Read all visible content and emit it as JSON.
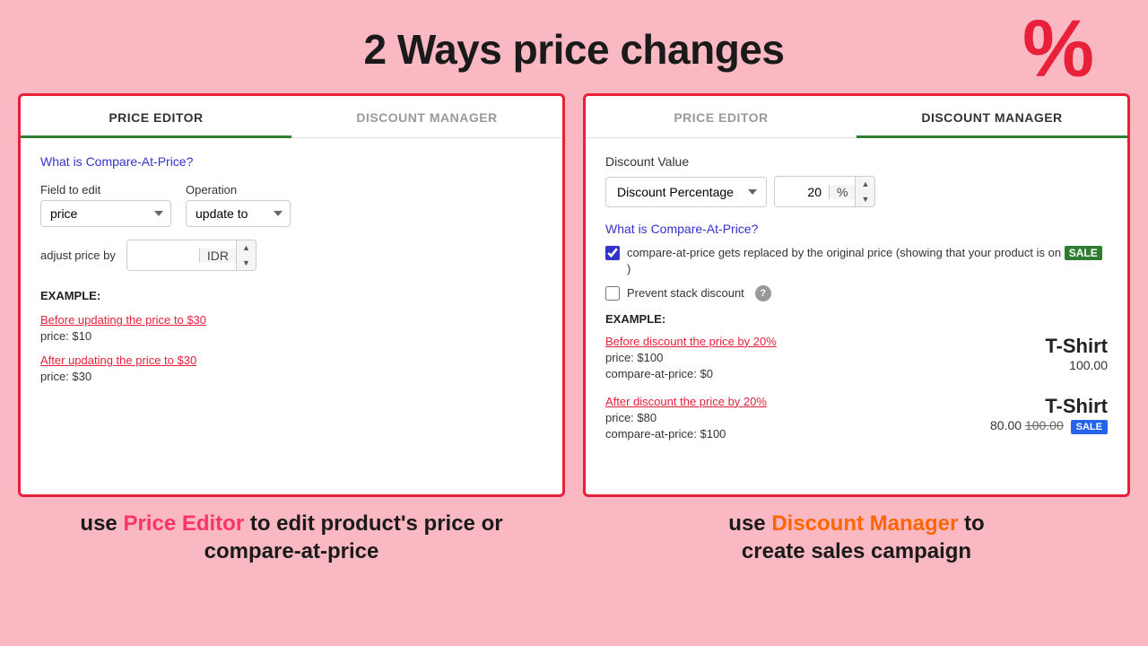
{
  "header": {
    "title": "2 Ways price changes",
    "icon": "%"
  },
  "left_panel": {
    "tabs": [
      {
        "label": "PRICE EDITOR",
        "active": true
      },
      {
        "label": "DISCOUNT MANAGER",
        "active": false
      }
    ],
    "compare_link": "What is Compare-At-Price?",
    "field_to_edit_label": "Field to edit",
    "field_to_edit_value": "price",
    "operation_label": "Operation",
    "operation_value": "update to",
    "adjust_label": "adjust price by",
    "adjust_value": "",
    "adjust_currency": "IDR",
    "example_heading": "EXAMPLE:",
    "before_link": "Before updating the price to $30",
    "before_price": "price:  $10",
    "after_link": "After updating the price to $30",
    "after_price": "price:  $30"
  },
  "right_panel": {
    "tabs": [
      {
        "label": "PRICE EDITOR",
        "active": false
      },
      {
        "label": "DISCOUNT MANAGER",
        "active": true
      }
    ],
    "discount_value_label": "Discount Value",
    "discount_type": "Discount Percentage",
    "discount_number": "20",
    "discount_pct_symbol": "%",
    "compare_link": "What is Compare-At-Price?",
    "checkbox1_label": "compare-at-price gets replaced by the original price (showing that your product is on",
    "sale_badge": "SALE",
    "checkbox1_checked": true,
    "checkbox2_label": "Prevent stack discount",
    "checkbox2_checked": false,
    "example_heading": "EXAMPLE:",
    "before_link": "Before discount the price by 20%",
    "before_price": "price:  $100",
    "before_compare": "compare-at-price:  $0",
    "tshirt_title_before": "T-Shirt",
    "tshirt_price_before": "100.00",
    "after_link": "After discount the price by 20%",
    "after_price": "price:  $80",
    "after_compare": "compare-at-price:  $100",
    "tshirt_title_after": "T-Shirt",
    "tshirt_price_after": "80.00",
    "tshirt_price_original": "100.00",
    "sale_label": "SALE"
  },
  "footer": {
    "left_text1": "use",
    "left_highlight": "Price Editor",
    "left_text2": "to edit product's price or",
    "left_text3": "compare-at-price",
    "right_text1": "use",
    "right_highlight": "Discount Manager",
    "right_text2": "to",
    "right_text3": "create sales campaign"
  }
}
